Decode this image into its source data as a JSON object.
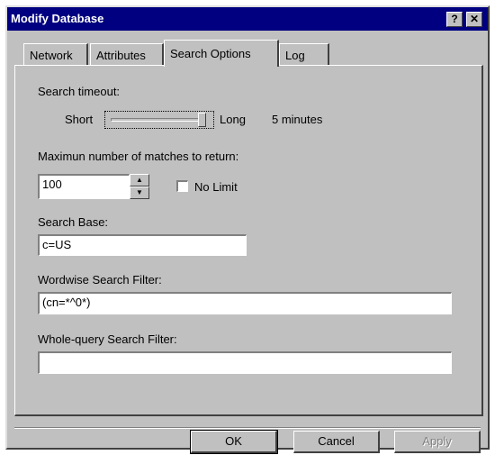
{
  "window": {
    "title": "Modify Database",
    "help_label": "?",
    "close_label": "✕"
  },
  "tabs": [
    {
      "label": "Network",
      "active": false
    },
    {
      "label": "Attributes",
      "active": false
    },
    {
      "label": "Search Options",
      "active": true
    },
    {
      "label": "Log",
      "active": false
    }
  ],
  "search_timeout": {
    "label": "Search timeout:",
    "min_label": "Short",
    "max_label": "Long",
    "value_text": "5 minutes",
    "level": 1.0
  },
  "max_matches": {
    "label": "Maximun number of matches to return:",
    "value": "100",
    "no_limit_label": "No Limit",
    "no_limit_checked": false
  },
  "search_base": {
    "label": "Search Base:",
    "value": "c=US"
  },
  "wordwise_filter": {
    "label": "Wordwise Search Filter:",
    "value": "(cn=*^0*)"
  },
  "wholequery_filter": {
    "label": "Whole-query Search Filter:",
    "value": ""
  },
  "buttons": {
    "ok": "OK",
    "cancel": "Cancel",
    "apply": "Apply"
  },
  "colors": {
    "titlebar": "#000080",
    "face": "#c0c0c0"
  }
}
